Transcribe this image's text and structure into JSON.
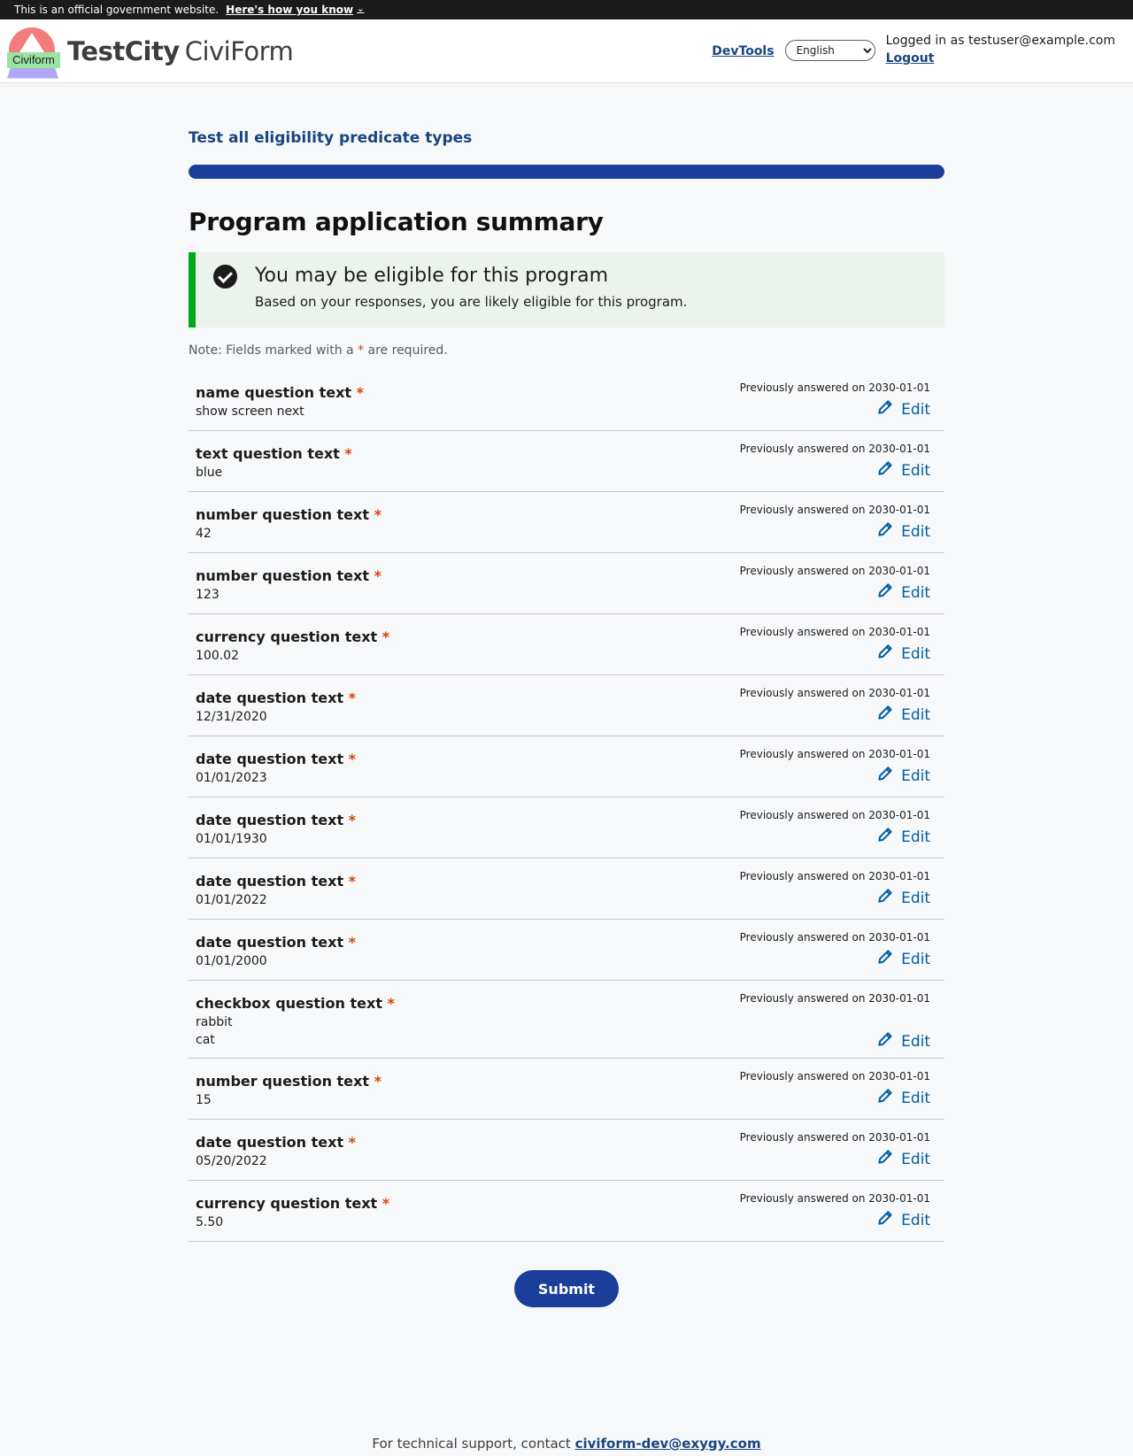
{
  "banner": {
    "text": "This is an official government website.",
    "link": "Here's how you know",
    "chevron_icon": "chevron-down-icon"
  },
  "header": {
    "logo_text": "Civiform",
    "brand_city": "TestCity",
    "brand_product": "CiviForm",
    "devtools_label": "DevTools",
    "language": "English",
    "logged_in_text": "Logged in as testuser@example.com",
    "logout_label": "Logout"
  },
  "program": {
    "title": "Test all eligibility predicate types",
    "progress": 1.0,
    "heading": "Program application summary"
  },
  "alert": {
    "icon": "check-circle-icon",
    "heading": "You may be eligible for this program",
    "body": "Based on your responses, you are likely eligible for this program."
  },
  "note": {
    "prefix": "Note: Fields marked with a ",
    "star": "*",
    "suffix": " are required."
  },
  "rows": [
    {
      "question": "name question text",
      "answers": [
        "show screen next"
      ],
      "previous": "Previously answered on 2030-01-01",
      "edit": "Edit"
    },
    {
      "question": "text question text",
      "answers": [
        "blue"
      ],
      "previous": "Previously answered on 2030-01-01",
      "edit": "Edit"
    },
    {
      "question": "number question text",
      "answers": [
        "42"
      ],
      "previous": "Previously answered on 2030-01-01",
      "edit": "Edit"
    },
    {
      "question": "number question text",
      "answers": [
        "123"
      ],
      "previous": "Previously answered on 2030-01-01",
      "edit": "Edit"
    },
    {
      "question": "currency question text",
      "answers": [
        "100.02"
      ],
      "previous": "Previously answered on 2030-01-01",
      "edit": "Edit"
    },
    {
      "question": "date question text",
      "answers": [
        "12/31/2020"
      ],
      "previous": "Previously answered on 2030-01-01",
      "edit": "Edit"
    },
    {
      "question": "date question text",
      "answers": [
        "01/01/2023"
      ],
      "previous": "Previously answered on 2030-01-01",
      "edit": "Edit"
    },
    {
      "question": "date question text",
      "answers": [
        "01/01/1930"
      ],
      "previous": "Previously answered on 2030-01-01",
      "edit": "Edit"
    },
    {
      "question": "date question text",
      "answers": [
        "01/01/2022"
      ],
      "previous": "Previously answered on 2030-01-01",
      "edit": "Edit"
    },
    {
      "question": "date question text",
      "answers": [
        "01/01/2000"
      ],
      "previous": "Previously answered on 2030-01-01",
      "edit": "Edit"
    },
    {
      "question": "checkbox question text",
      "answers": [
        "rabbit",
        "cat"
      ],
      "previous": "Previously answered on 2030-01-01",
      "edit": "Edit"
    },
    {
      "question": "number question text",
      "answers": [
        "15"
      ],
      "previous": "Previously answered on 2030-01-01",
      "edit": "Edit"
    },
    {
      "question": "date question text",
      "answers": [
        "05/20/2022"
      ],
      "previous": "Previously answered on 2030-01-01",
      "edit": "Edit"
    },
    {
      "question": "currency question text",
      "answers": [
        "5.50"
      ],
      "previous": "Previously answered on 2030-01-01",
      "edit": "Edit"
    }
  ],
  "required_star": "*",
  "submit_label": "Submit",
  "footer": {
    "text": "For technical support, contact ",
    "email": "civiform-dev@exygy.com"
  },
  "colors": {
    "primary": "#1a3e99",
    "link": "#1a4480",
    "success": "#00a91c",
    "required": "#d54309",
    "edit": "#005ea2"
  }
}
